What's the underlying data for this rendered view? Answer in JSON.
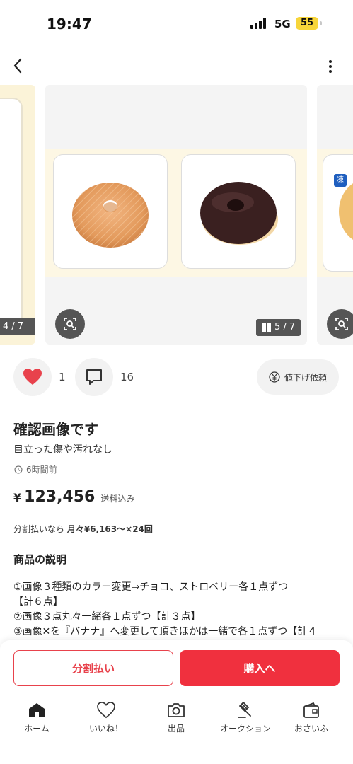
{
  "status_bar": {
    "time": "19:47",
    "network": "5G",
    "battery": "55"
  },
  "carousel": {
    "prev_count": "4 / 7",
    "current_count": "5 / 7",
    "next_badge": "凍"
  },
  "actions": {
    "like_count": "1",
    "comment_count": "16",
    "price_down_label": "値下げ依頼"
  },
  "item": {
    "title": "確認画像です",
    "subtitle": "目立った傷や汚れなし",
    "posted": "6時間前",
    "price_yen": "¥",
    "price": "123,456",
    "shipping": "送料込み",
    "installment_prefix": "分割払いなら ",
    "installment_value": "月々¥6,163〜×24回",
    "description_heading": "商品の説明",
    "description_lines": [
      "①画像３種類のカラー変更⇒チョコ、ストロベリー各１点ずつ",
      "【計６点】",
      "②画像３点丸々一緒各１点ずつ【計３点】",
      "③画像✕を『バナナ』へ変更して頂きほかは一緒で各１点ずつ【計４"
    ]
  },
  "purchase": {
    "split_label": "分割払い",
    "buy_label": "購入へ"
  },
  "tabs": [
    {
      "label": "ホーム",
      "icon": "home-icon"
    },
    {
      "label": "いいね！",
      "icon": "heart-icon"
    },
    {
      "label": "出品",
      "icon": "camera-icon"
    },
    {
      "label": "オークション",
      "icon": "gavel-icon"
    },
    {
      "label": "おさいふ",
      "icon": "wallet-icon"
    }
  ],
  "colors": {
    "accent_red": "#f0303e",
    "like_red": "#e8424c",
    "battery_yellow": "#f7d53a"
  }
}
